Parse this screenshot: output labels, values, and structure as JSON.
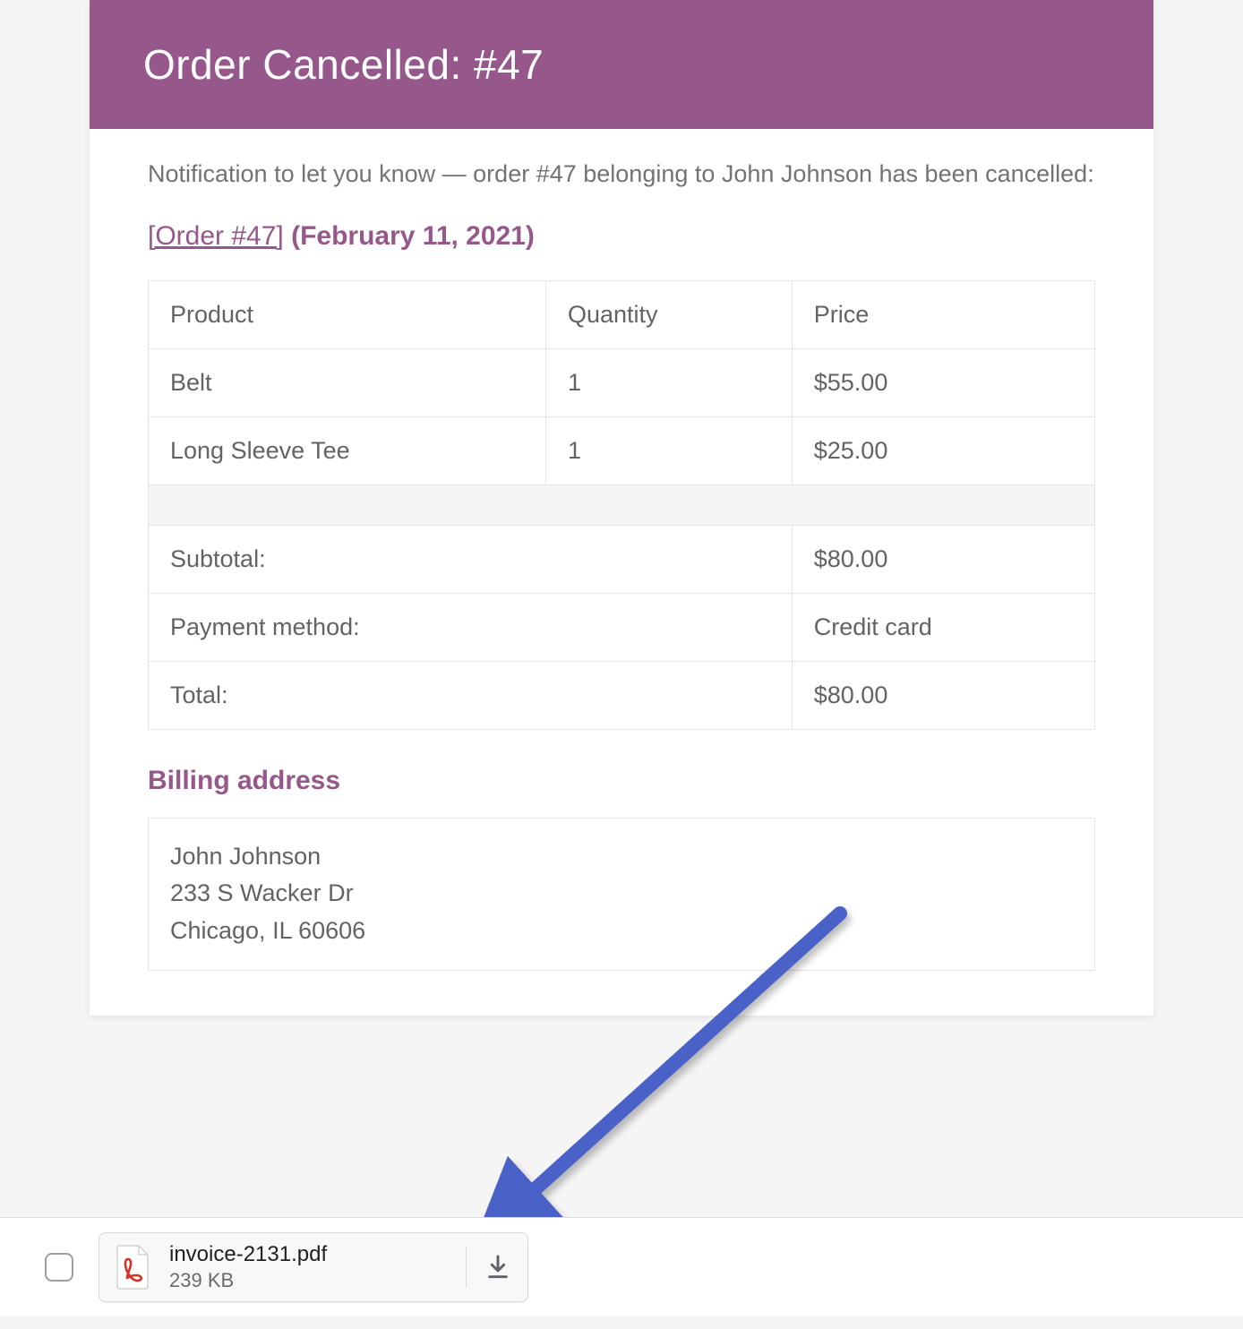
{
  "header": {
    "title": "Order Cancelled: #47"
  },
  "notice": "Notification to let you know — order #47 belonging to John Johnson has been cancelled:",
  "order_link": "[Order #47]",
  "order_date": "(February 11, 2021)",
  "table": {
    "headers": {
      "product": "Product",
      "quantity": "Quantity",
      "price": "Price"
    },
    "rows": [
      {
        "product": "Belt",
        "quantity": "1",
        "price": "$55.00"
      },
      {
        "product": "Long Sleeve Tee",
        "quantity": "1",
        "price": "$25.00"
      }
    ],
    "summary": [
      {
        "label": "Subtotal:",
        "value": "$80.00"
      },
      {
        "label": "Payment method:",
        "value": "Credit card"
      },
      {
        "label": "Total:",
        "value": "$80.00"
      }
    ]
  },
  "billing": {
    "heading": "Billing address",
    "name": "John Johnson",
    "street": "233 S Wacker Dr",
    "city": "Chicago, IL 60606"
  },
  "attachment": {
    "filename": "invoice-2131.pdf",
    "size": "239 KB"
  }
}
